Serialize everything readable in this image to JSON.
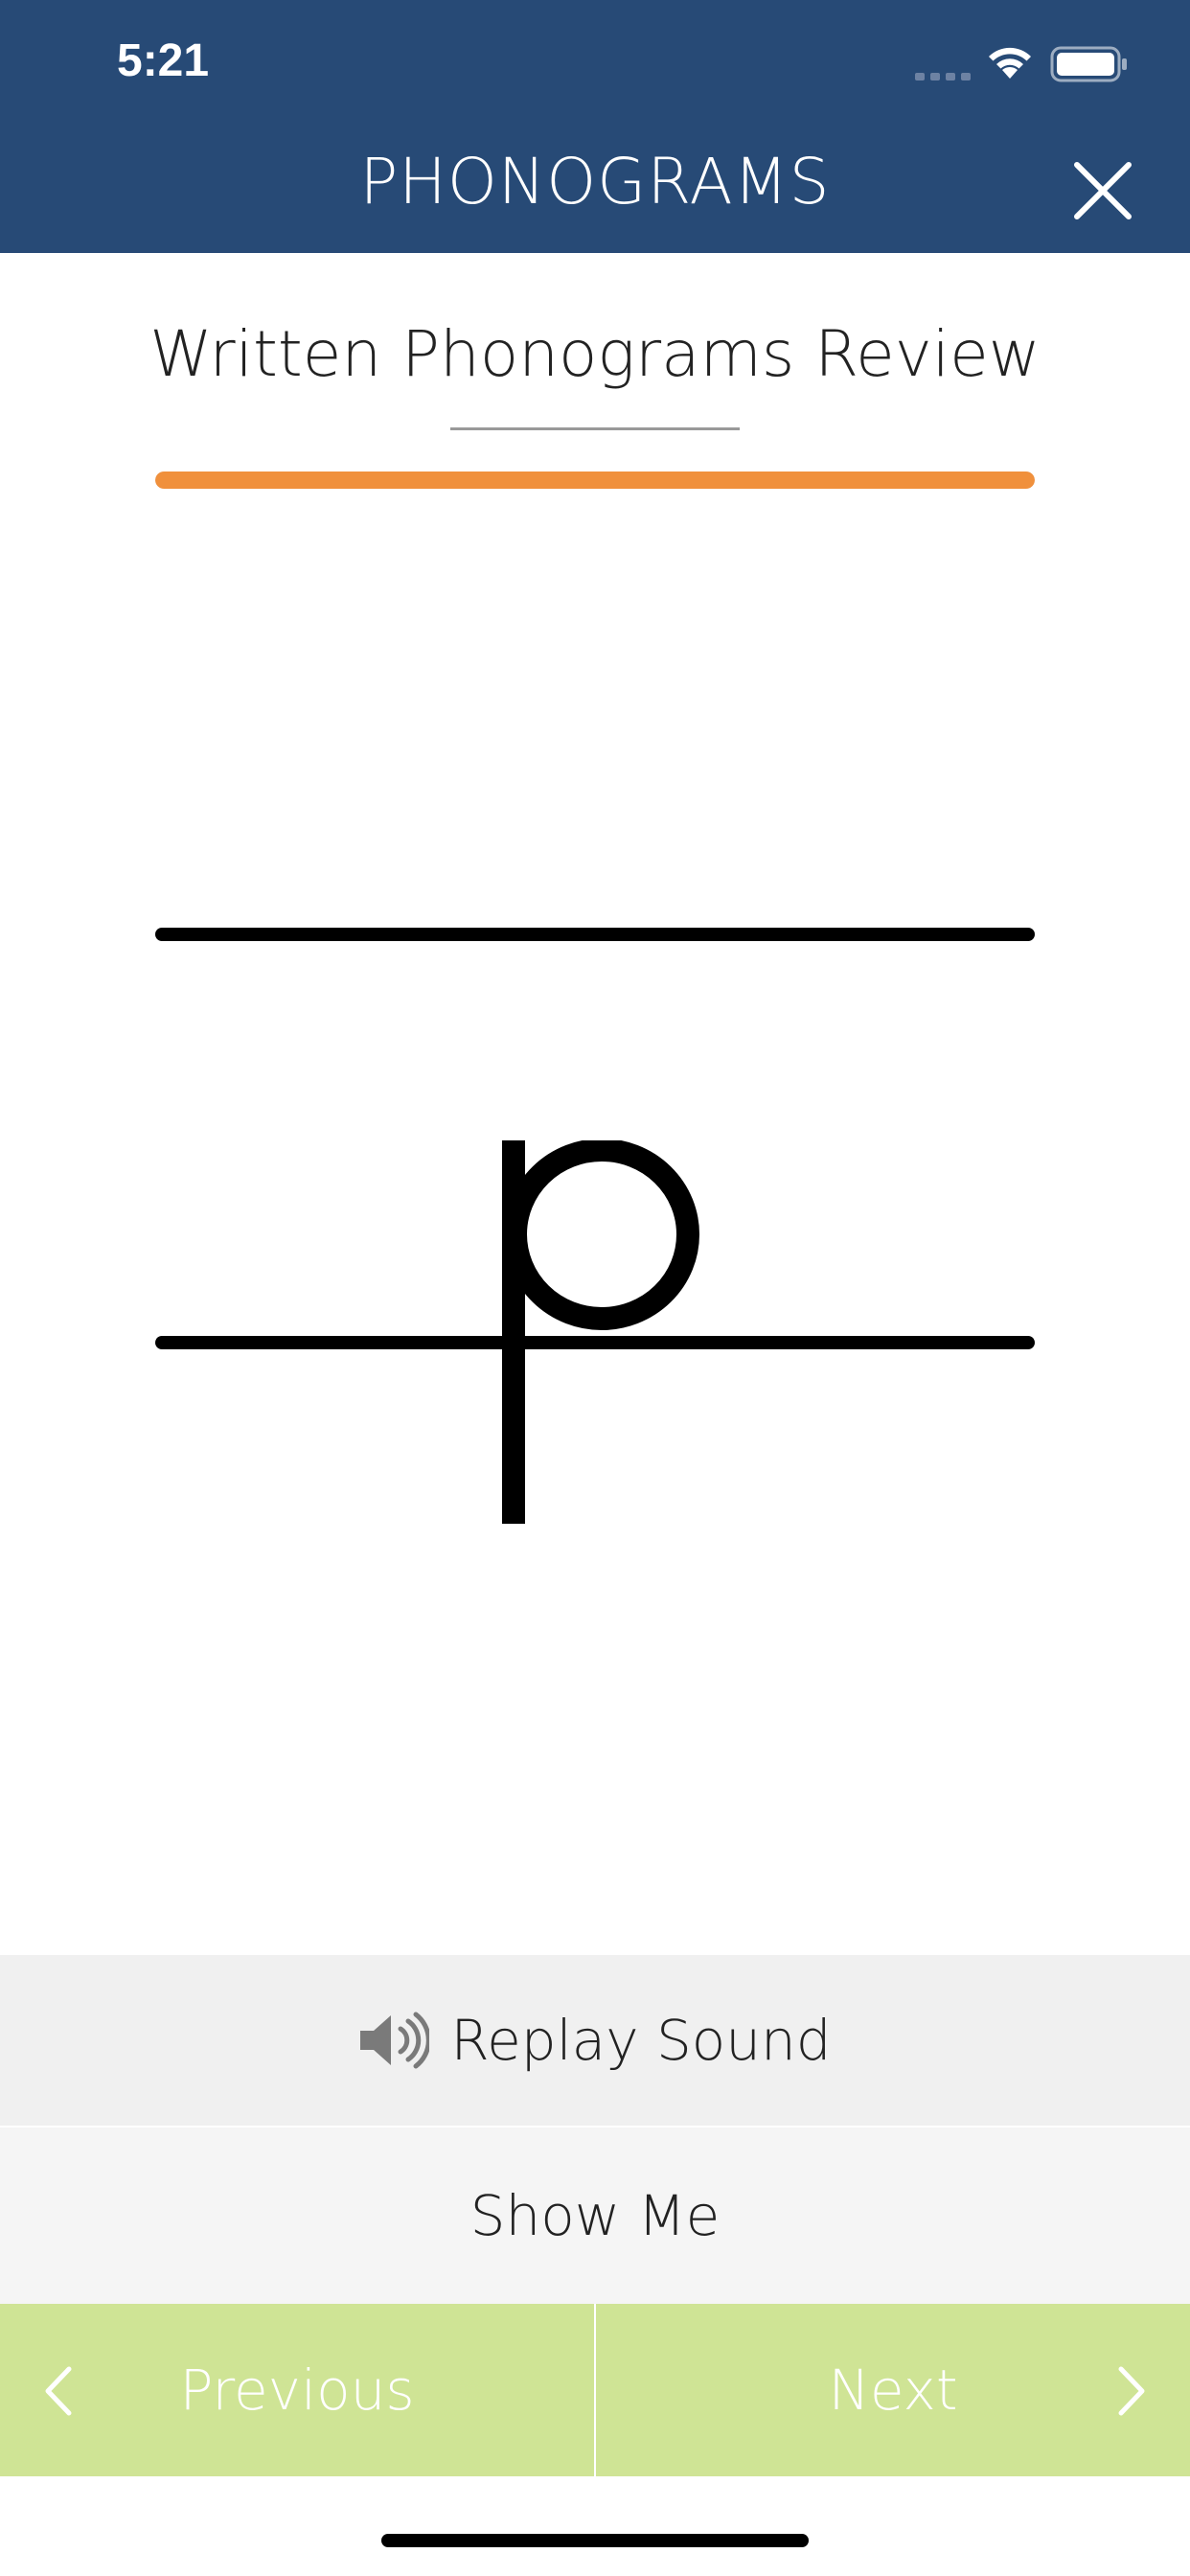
{
  "status_bar": {
    "time": "5:21"
  },
  "header": {
    "title": "PHONOGRAMS",
    "close_icon": "close-icon",
    "background": "#274a76"
  },
  "page": {
    "title": "Written Phonograms Review"
  },
  "progress": {
    "fraction": 1.0,
    "color": "#f0903c"
  },
  "phonogram": {
    "letter": "p"
  },
  "actions": {
    "replay_label": "Replay Sound",
    "replay_icon": "speaker-icon",
    "show_me_label": "Show Me"
  },
  "navigation": {
    "previous_label": "Previous",
    "next_label": "Next",
    "previous_icon": "chevron-left-icon",
    "next_icon": "chevron-right-icon",
    "background": "#cfe495"
  }
}
